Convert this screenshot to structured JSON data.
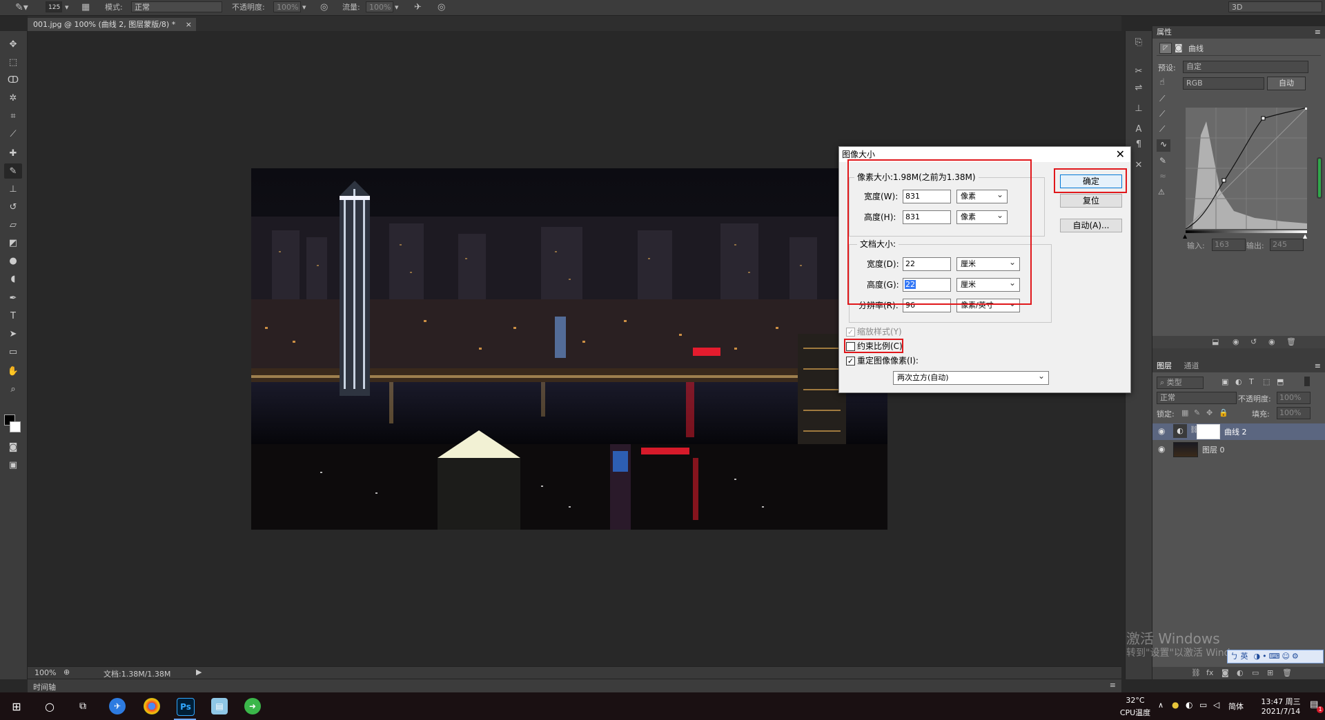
{
  "optionbar": {
    "brush_size": "125",
    "mode_label": "模式:",
    "mode_value": "正常",
    "opacity_label": "不透明度:",
    "opacity_value": "100%",
    "flow_label": "流量:",
    "flow_value": "100%",
    "workspace": "3D"
  },
  "document": {
    "tab_title": "001.jpg @ 100% (曲线 2, 图层蒙版/8) *",
    "zoom": "100%",
    "doc_info": "文档:1.38M/1.38M",
    "timeline_label": "时间轴"
  },
  "dialog": {
    "title": "图像大小",
    "pixel_size_title": "像素大小:1.98M(之前为1.38M)",
    "pixel_width_label": "宽度(W):",
    "pixel_width_value": "831",
    "pixel_width_unit": "像素",
    "pixel_height_label": "高度(H):",
    "pixel_height_value": "831",
    "pixel_height_unit": "像素",
    "doc_size_title": "文档大小:",
    "doc_width_label": "宽度(D):",
    "doc_width_value": "22",
    "doc_width_unit": "厘米",
    "doc_height_label": "高度(G):",
    "doc_height_value": "22",
    "doc_height_unit": "厘米",
    "resolution_label": "分辨率(R):",
    "resolution_value": "96",
    "resolution_unit": "像素/英寸",
    "scale_styles_label": "缩放样式(Y)",
    "constrain_label": "约束比例(C)",
    "resample_label": "重定图像像素(I):",
    "resample_method": "两次立方(自动)",
    "ok_label": "确定",
    "reset_label": "复位",
    "auto_label": "自动(A)..."
  },
  "properties": {
    "tab_label": "属性",
    "header_label": "曲线",
    "preset_label": "预设:",
    "preset_value": "自定",
    "channel_value": "RGB",
    "auto_label": "自动",
    "input_label": "输入:",
    "input_value": "163",
    "output_label": "输出:",
    "output_value": "245"
  },
  "layers": {
    "tab_layers": "图层",
    "tab_channels": "通道",
    "filter_label": "类型",
    "blend_mode": "正常",
    "opacity_label": "不透明度:",
    "opacity_value": "100%",
    "lock_label": "锁定:",
    "fill_label": "填充:",
    "fill_value": "100%",
    "items": [
      {
        "name": "曲线 2"
      },
      {
        "name": "图层 0"
      }
    ]
  },
  "watermark": {
    "line1": "激活 Windows",
    "line2": "转到\"设置\"以激活 Windows。"
  },
  "ime_toolbar": "英",
  "taskbar": {
    "temp": "32°C",
    "cpu_label": "CPU温度",
    "ime_lang": "简体",
    "time": "13:47 周三",
    "date": "2021/7/14",
    "notification_count": "1"
  },
  "colors": {
    "accent_red": "#e0161a",
    "selection_blue": "#3478f6"
  }
}
